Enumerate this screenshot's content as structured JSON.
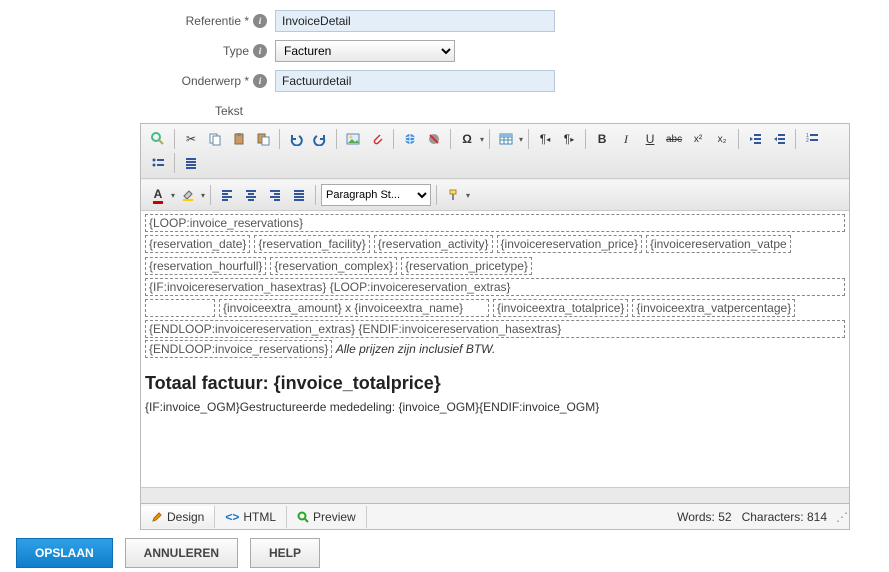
{
  "form": {
    "reference_label": "Referentie *",
    "reference_value": "InvoiceDetail",
    "type_label": "Type",
    "type_value": "Facturen",
    "subject_label": "Onderwerp *",
    "subject_value": "Factuurdetail",
    "text_label": "Tekst"
  },
  "toolbar": {
    "paragraph_styles": "Paragraph St..."
  },
  "content": {
    "loop_open": "{LOOP:invoice_reservations}",
    "r1": {
      "c1": "{reservation_date}",
      "c2": "{reservation_facility}",
      "c3": "{reservation_activity}",
      "c4": "{invoicereservation_price}",
      "c5": "{invoicereservation_vatpe"
    },
    "r2": {
      "c1": "{reservation_hourfull}",
      "c2": "{reservation_complex}",
      "c3": "{reservation_pricetype}"
    },
    "if_extras": "{IF:invoicereservation_hasextras} {LOOP:invoicereservation_extras}",
    "r3": {
      "left": "{invoiceextra_amount} x {invoiceextra_name}",
      "mid": "{invoiceextra_totalprice}",
      "right": "{invoiceextra_vatpercentage}"
    },
    "end_extras": "{ENDLOOP:invoicereservation_extras} {ENDIF:invoicereservation_hasextras}",
    "end_loop": "{ENDLOOP:invoice_reservations}",
    "note_italic": " Alle prijzen zijn inclusief BTW.",
    "total_line": "Totaal factuur: {invoice_totalprice}",
    "ogm_line": "{IF:invoice_OGM}Gestructureerde mededeling: {invoice_OGM}{ENDIF:invoice_OGM}"
  },
  "footer": {
    "design": "Design",
    "html": "HTML",
    "preview": "Preview",
    "words_label": "Words:",
    "words": "52",
    "chars_label": "Characters:",
    "chars": "814"
  },
  "buttons": {
    "save": "OPSLAAN",
    "cancel": "ANNULEREN",
    "help": "HELP"
  }
}
